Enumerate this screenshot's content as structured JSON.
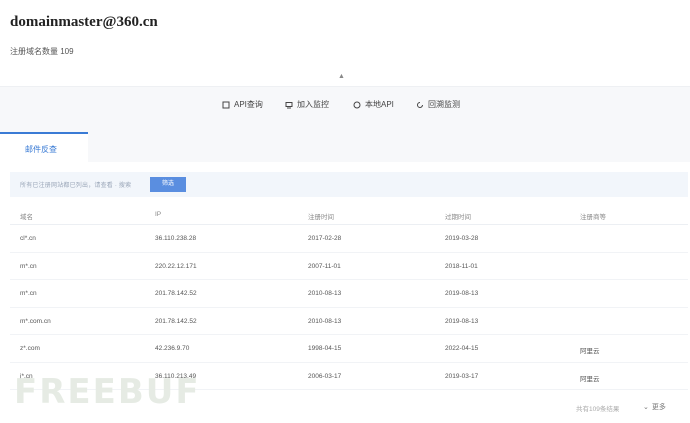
{
  "header": {
    "title": "domainmaster@360.cn",
    "subtitle": "注册域名数量 109",
    "collapse_icon": "chevron-up-icon"
  },
  "toolbar": {
    "items": [
      {
        "label": "API查询",
        "icon": "api-icon"
      },
      {
        "label": "加入监控",
        "icon": "monitor-icon"
      },
      {
        "label": "本地API",
        "icon": "local-api-icon"
      },
      {
        "label": "回溯监测",
        "icon": "refresh-icon"
      }
    ]
  },
  "tabs": [
    {
      "label": "邮件反查"
    }
  ],
  "filter": {
    "text": "所有已注册网站都已列出，请查看 · 搜索",
    "button": "筛选"
  },
  "table": {
    "headers": [
      "域名",
      "IP",
      "注册时间",
      "过期时间",
      "注册商等"
    ],
    "rows": [
      [
        "cl*.cn",
        "36.110.238.28",
        "2017-02-28",
        "2019-03-28",
        ""
      ],
      [
        "m*.cn",
        "220.22.12.171",
        "2007-11-01",
        "2018-11-01",
        ""
      ],
      [
        "m*.cn",
        "201.78.142.52",
        "2010-08-13",
        "2019-08-13",
        ""
      ],
      [
        "m*.com.cn",
        "201.78.142.52",
        "2010-08-13",
        "2019-08-13",
        ""
      ],
      [
        "z*.com",
        "42.236.9.70",
        "1998-04-15",
        "2022-04-15",
        "阿里云"
      ],
      [
        "j*.cn",
        "36.110.213.49",
        "2006-03-17",
        "2019-03-17",
        "阿里云"
      ]
    ]
  },
  "footer": {
    "pager_text": "共有109条结果",
    "more_label": "更多"
  },
  "watermark": "FREEBUF",
  "colors": {
    "accent": "#3a7bd5",
    "button": "#5a8ee0"
  }
}
